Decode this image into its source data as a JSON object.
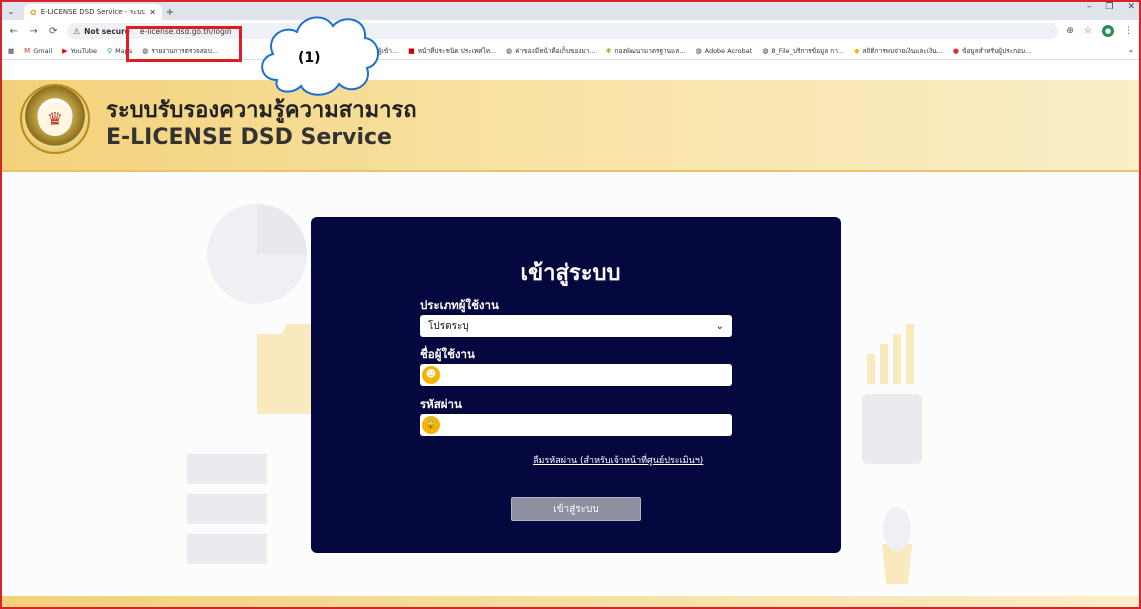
{
  "browser": {
    "tab_title": "E-LICENSE DSD Service - ระบบรั",
    "url_warning": "Not secure",
    "url": "e-license.dsd.go.th/login",
    "bookmarks": [
      {
        "label": "Gmail",
        "icon": "gmail-icon"
      },
      {
        "label": "YouTube",
        "icon": "youtube-icon"
      },
      {
        "label": "Maps",
        "icon": "maps-icon"
      },
      {
        "label": "รายงานการตรวจสอบ...",
        "icon": "globe-icon"
      },
      {
        "label": "ตรวจสอบข้อมูลผู้เข้า...",
        "icon": "globe-icon"
      },
      {
        "label": "หน้าที่ประชนิด ประเทศไท...",
        "icon": "doc-icon"
      },
      {
        "label": "ค่าของมีหน้าคือเก็บของมา...",
        "icon": "globe-icon"
      },
      {
        "label": "กองพัฒนามาตรฐานแล...",
        "icon": "globe-icon"
      },
      {
        "label": "Adobe Acrobat",
        "icon": "globe-icon"
      },
      {
        "label": "8_File_บริการข้อมูล กา...",
        "icon": "globe-icon"
      },
      {
        "label": "สถิติการพบจ่ายเงินและเงิน...",
        "icon": "globe-icon"
      },
      {
        "label": "ข้อมูลสำหรับผู้ประกอบ...",
        "icon": "globe-icon"
      }
    ],
    "more_bookmarks": "»"
  },
  "annotation": {
    "callout_label": "(1)"
  },
  "site": {
    "title_thai": "ระบบรับรองความรู้ความสามารถ",
    "title_english": "E-LICENSE DSD Service"
  },
  "login": {
    "heading": "เข้าสู่ระบบ",
    "user_type_label": "ประเภทผู้ใช้งาน",
    "user_type_selected": "โปรดระบุ",
    "username_label": "ชื่อผู้ใช้งาน",
    "username_value": "",
    "password_label": "รหัสผ่าน",
    "password_value": "",
    "forgot_password_link": "ลืมรหัสผ่าน (สำหรับเจ้าหน้าที่ศูนย์ประเมินฯ)",
    "submit_label": "เข้าสู่ระบบ"
  },
  "colors": {
    "card_bg": "#05083f",
    "header_gold": "#f3d17a",
    "highlight_red": "#e01b24",
    "icon_badge": "#f4b400"
  }
}
